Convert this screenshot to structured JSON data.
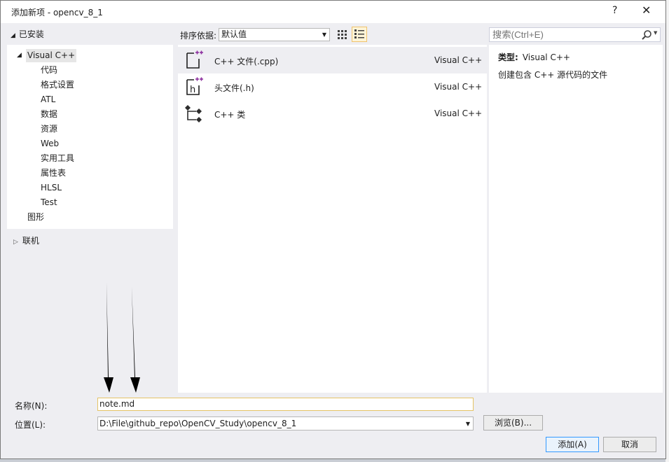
{
  "window": {
    "title": "添加新项 - opencv_8_1",
    "help_label": "?",
    "close_label": "✕"
  },
  "left": {
    "installed": "已安装",
    "tree": [
      {
        "label": "Visual C++"
      },
      {
        "label": "代码"
      },
      {
        "label": "格式设置"
      },
      {
        "label": "ATL"
      },
      {
        "label": "数据"
      },
      {
        "label": "资源"
      },
      {
        "label": "Web"
      },
      {
        "label": "实用工具"
      },
      {
        "label": "属性表"
      },
      {
        "label": "HLSL"
      },
      {
        "label": "Test"
      },
      {
        "label": "图形"
      }
    ],
    "online": "联机"
  },
  "toolbar": {
    "sort_label": "排序依据:",
    "sort_value": "默认值"
  },
  "templates": [
    {
      "name": "C++ 文件(.cpp)",
      "lang": "Visual C++",
      "icon": "cpp-file-icon"
    },
    {
      "name": "头文件(.h)",
      "lang": "Visual C++",
      "icon": "header-file-icon"
    },
    {
      "name": "C++ 类",
      "lang": "Visual C++",
      "icon": "cpp-class-icon"
    }
  ],
  "search": {
    "placeholder": "搜索(Ctrl+E)"
  },
  "description": {
    "type_label": "类型:",
    "type_value": "Visual C++",
    "text": "创建包含 C++ 源代码的文件"
  },
  "form": {
    "name_label": "名称(N):",
    "name_value": "note.md",
    "location_label": "位置(L):",
    "location_value": "D:\\File\\github_repo\\OpenCV_Study\\opencv_8_1",
    "browse_label": "浏览(B)...",
    "add_label": "添加(A)",
    "cancel_label": "取消"
  },
  "colors": {
    "accent": "#3399ff",
    "icon_purple": "#8c2d9e",
    "name_border": "#e5c365"
  }
}
